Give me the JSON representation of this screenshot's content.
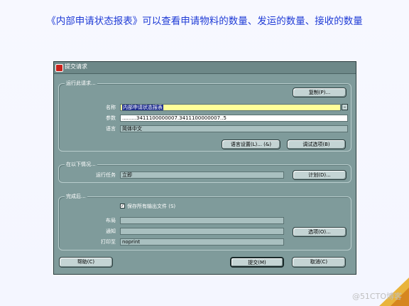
{
  "slide": {
    "title": "《内部申请状态报表》可以查看申请物料的数量、发运的数量、接收的数量",
    "watermark": "@51CTO博客"
  },
  "dialog": {
    "title": "提交请求",
    "run_request": {
      "group_label": "运行此请求...",
      "copy_button": "复制(P)...",
      "name_label": "名称",
      "name_value": "内部申请状态报表",
      "params_label": "参数",
      "params_value": ".........3411100000007.3411100000007..5",
      "language_label": "语言",
      "language_value": "简体中文",
      "language_settings_button": "语言设置(L)... (&)",
      "debug_options_button": "调试选项(B)"
    },
    "schedule": {
      "group_label": "在以下情况...",
      "run_task_label": "运行任务",
      "run_task_value": "立即",
      "schedule_button": "计划(D)..."
    },
    "completion": {
      "group_label": "完成后...",
      "save_outputs_label": "保存所有输出文件 (S)",
      "save_outputs_checked": true,
      "layout_label": "布局",
      "layout_value": "",
      "notify_label": "通知",
      "notify_value": "",
      "print_to_label": "打印至",
      "print_to_value": "noprint",
      "options_button": "选项(O)..."
    },
    "help_button": "帮助(C)",
    "submit_button": "提交(M)",
    "cancel_button": "取消(C)"
  }
}
